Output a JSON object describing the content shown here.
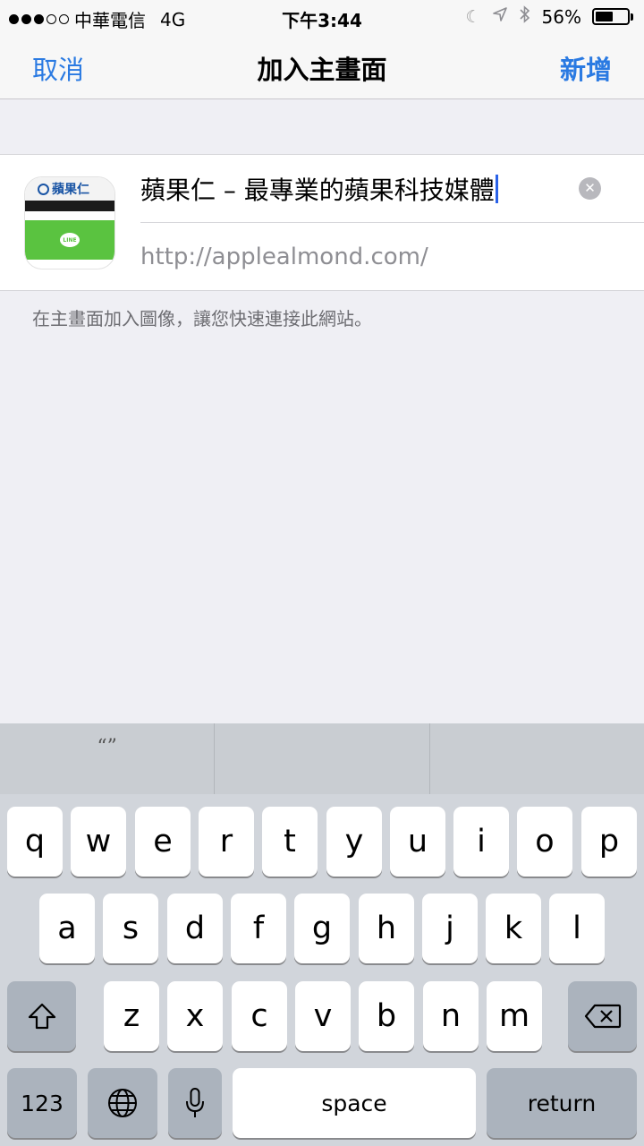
{
  "status_bar": {
    "carrier": "中華電信",
    "network": "4G",
    "time": "下午3:44",
    "battery": "56%",
    "battery_level": 0.56
  },
  "nav": {
    "cancel": "取消",
    "title": "加入主畫面",
    "add": "新增"
  },
  "form": {
    "title_value": "蘋果仁 – 最專業的蘋果科技媒體",
    "url": "http://applealmond.com/",
    "thumb_brand": "蘋果仁",
    "thumb_bubble": "LINE"
  },
  "hint": "在主畫面加入圖像，讓您快速連接此網站。",
  "keyboard": {
    "suggestions": [
      "“”",
      "",
      ""
    ],
    "row1": [
      "q",
      "w",
      "e",
      "r",
      "t",
      "y",
      "u",
      "i",
      "o",
      "p"
    ],
    "row2": [
      "a",
      "s",
      "d",
      "f",
      "g",
      "h",
      "j",
      "k",
      "l"
    ],
    "row3": [
      "z",
      "x",
      "c",
      "v",
      "b",
      "n",
      "m"
    ],
    "numbers": "123",
    "space": "space",
    "return": "return"
  },
  "colors": {
    "accent": "#2a7ae2",
    "background": "#efeff4",
    "keyboard_bg": "#d1d5db"
  }
}
